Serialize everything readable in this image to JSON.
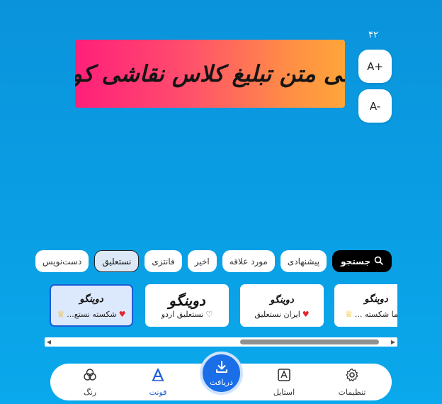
{
  "font_size": {
    "value": "۴۲",
    "increase_label": "A+",
    "decrease_label": "A-"
  },
  "banner": {
    "text": "طراحی متن تبلیغ کلاس نقاشی کودکان"
  },
  "tabs": [
    {
      "label": "جستجو",
      "icon": "search-icon"
    },
    {
      "label": "پیشنهادی"
    },
    {
      "label": "مورد علاقه"
    },
    {
      "label": "اخیر"
    },
    {
      "label": "فانتزی"
    },
    {
      "label": "نستعلیق"
    },
    {
      "label": "دست‌نویس"
    }
  ],
  "font_cards": [
    {
      "sample": "دوینگو",
      "name": "شکسته نستع...",
      "badge": "heart-icon"
    },
    {
      "sample": "دوینگو",
      "name": "نستعلیق اردو",
      "badge": "heart-outline-icon"
    },
    {
      "sample": "دوینگو",
      "name": "ایران نستعلیق",
      "badge": "heart-icon"
    },
    {
      "sample": "دوینگو",
      "name": "سیما شکسته ...",
      "badge": "crown-icon"
    }
  ],
  "bottom_nav": {
    "color": "رنگ",
    "font": "فونت",
    "download": "دریافت",
    "style": "استایل",
    "settings": "تنظیمات"
  },
  "colors": {
    "accent": "#1a6fe8",
    "background": "#0a9fe4",
    "banner_start": "#ff1f7a",
    "banner_end": "#ffa53a"
  }
}
